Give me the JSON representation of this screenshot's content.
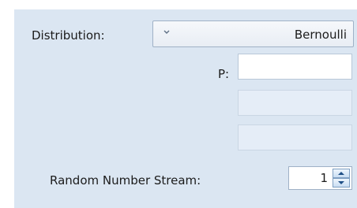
{
  "distribution": {
    "label": "Distribution:",
    "selected": "Bernoulli"
  },
  "parameters": {
    "p_label": "P:",
    "p_value": "",
    "param2_value": "",
    "param3_value": ""
  },
  "random_stream": {
    "label": "Random Number Stream:",
    "value": "1"
  },
  "icons": {
    "dropdown": "chevron-down-icon",
    "spin_up": "triangle-up-icon",
    "spin_down": "triangle-down-icon"
  },
  "colors": {
    "panel_background": "#dbe6f2",
    "spinner_button": "#c9ddf2"
  }
}
